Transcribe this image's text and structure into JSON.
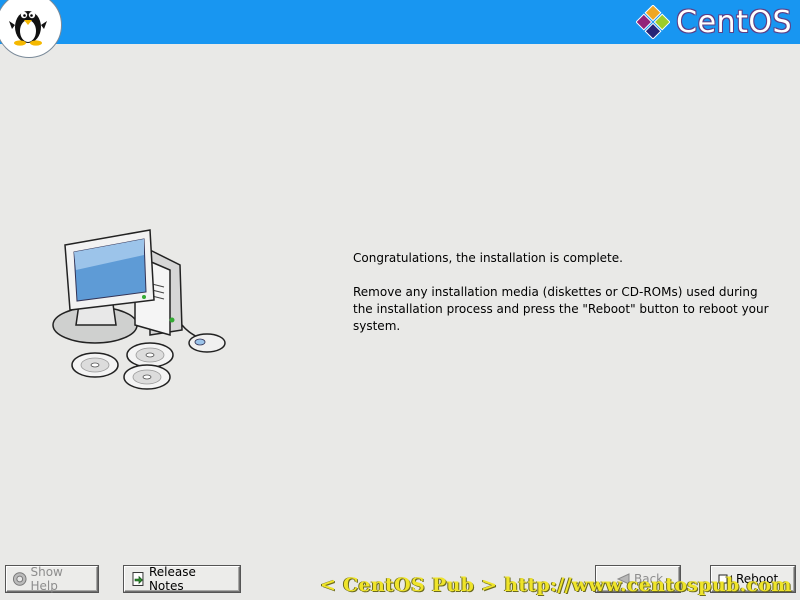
{
  "header": {
    "logo_text": "CentOS",
    "colors": {
      "bar": "#1896f1",
      "logo_outline": "#5d3f86"
    }
  },
  "message": {
    "line1": "Congratulations, the installation is complete.",
    "line2": "Remove any installation media (diskettes or CD-ROMs) used during the installation process and press the \"Reboot\" button to reboot your system."
  },
  "buttons": {
    "show_help": {
      "label": "Show Help",
      "icon": "help-icon",
      "enabled": false
    },
    "release_notes": {
      "label": "Release Notes",
      "icon": "release-notes-icon",
      "enabled": true
    },
    "back": {
      "label": "Back",
      "icon": "back-arrow-icon",
      "enabled": false
    },
    "reboot": {
      "label": "Reboot",
      "icon": "reboot-icon",
      "enabled": true
    }
  },
  "watermark": {
    "text": "< CentOS Pub > http://www.centospub.com",
    "color": "#efe42a"
  }
}
